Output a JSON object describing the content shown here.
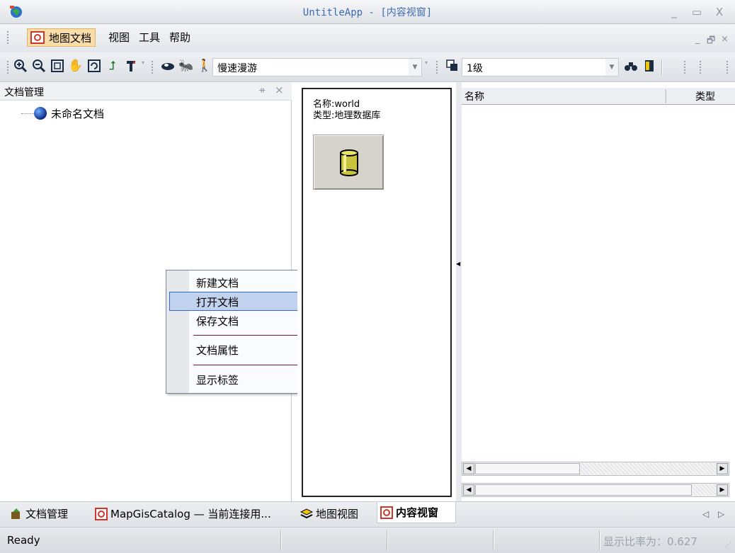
{
  "window": {
    "title": "UntitleApp - [内容视窗]",
    "minimize_glyph": "_",
    "maximize_glyph": "▭",
    "close_glyph": "X"
  },
  "menubar": {
    "items": [
      "地图文档",
      "视图",
      "工具",
      "帮助"
    ],
    "mdi_minimize": "_",
    "mdi_restore": "🗗",
    "mdi_close": "×"
  },
  "toolbar": {
    "icons": [
      "zoom-in-icon",
      "zoom-out-icon",
      "full-extent-icon",
      "pan-hand-icon",
      "refresh-icon",
      "back-icon",
      "tool-icon",
      "cursor-icon",
      "ant-icon",
      "walk-icon"
    ],
    "roam_combo": "慢速漫游",
    "level_combo": "1级",
    "combo_arrow": "▼"
  },
  "left_panel": {
    "title": "文档管理",
    "pin": "ᚑ",
    "close": "×",
    "tree_root": "未命名文档"
  },
  "context_menu": {
    "items": [
      "新建文档",
      "打开文档",
      "保存文档",
      "文档属性",
      "显示标签"
    ],
    "highlighted": "打开文档"
  },
  "content": {
    "name_line": "名称:world",
    "type_line": "类型:地理数据库",
    "list_columns": [
      "名称",
      "类型"
    ],
    "scroll_left": "◀",
    "scroll_right": "▶"
  },
  "bottom_tabs": {
    "tabs": [
      "文档管理",
      "MapGisCatalog — 当前连接用...",
      "地图视图",
      "内容视窗"
    ],
    "active": "内容视窗",
    "nav_left": "◁",
    "nav_right": "▷"
  },
  "statusbar": {
    "status": "Ready",
    "zoom_label": "显示比率为：0.627"
  },
  "colors": {
    "title_text": "#3a6bb5",
    "menu_highlight": "#f8dca9",
    "ctx_highlight": "#c1d2ee"
  }
}
